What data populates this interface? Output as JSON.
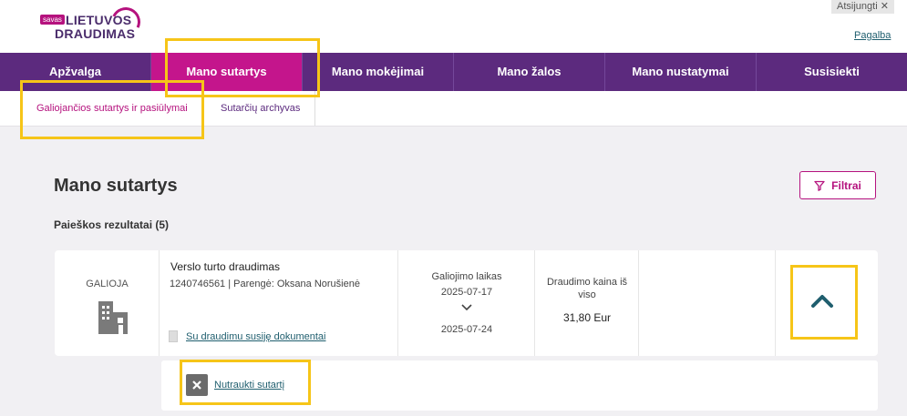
{
  "logo": {
    "badge": "savas",
    "line1": "LIETUVOS",
    "line2": "DRAUDIMAS"
  },
  "header": {
    "logout_label": "Atsijungti",
    "help_label": "Pagalba"
  },
  "main_nav": {
    "items": [
      {
        "label": "Apžvalga",
        "active": false
      },
      {
        "label": "Mano sutartys",
        "active": true
      },
      {
        "label": "Mano mokėjimai",
        "active": false
      },
      {
        "label": "Mano žalos",
        "active": false
      },
      {
        "label": "Mano nustatymai",
        "active": false
      },
      {
        "label": "Susisiekti",
        "active": false
      }
    ]
  },
  "sub_nav": {
    "items": [
      {
        "label": "Galiojančios sutartys ir pasiūlymai",
        "active": true
      },
      {
        "label": "Sutarčių archyvas",
        "active": false
      }
    ]
  },
  "content": {
    "title": "Mano sutartys",
    "results_label": "Paieškos rezultatai (5)",
    "filter_label": "Filtrai"
  },
  "policy": {
    "status": "GALIOJA",
    "icon": "building-icon",
    "title": "Verslo turto draudimas",
    "info": "1240746561 | Parengė: Oksana Norušienė",
    "docs_link": "Su draudimu susiję dokumentai",
    "validity_label": "Galiojimo laikas",
    "valid_from": "2025-07-17",
    "valid_to": "2025-07-24",
    "price_label": "Draudimo kaina iš viso",
    "price_value": "31,80 Eur",
    "cancel_label": "Nutraukti sutartį"
  },
  "colors": {
    "nav_bg": "#5c2a7e",
    "nav_active": "#c4158c",
    "accent": "#b5127e",
    "link": "#1f5e6e",
    "highlight": "#f6c518"
  }
}
